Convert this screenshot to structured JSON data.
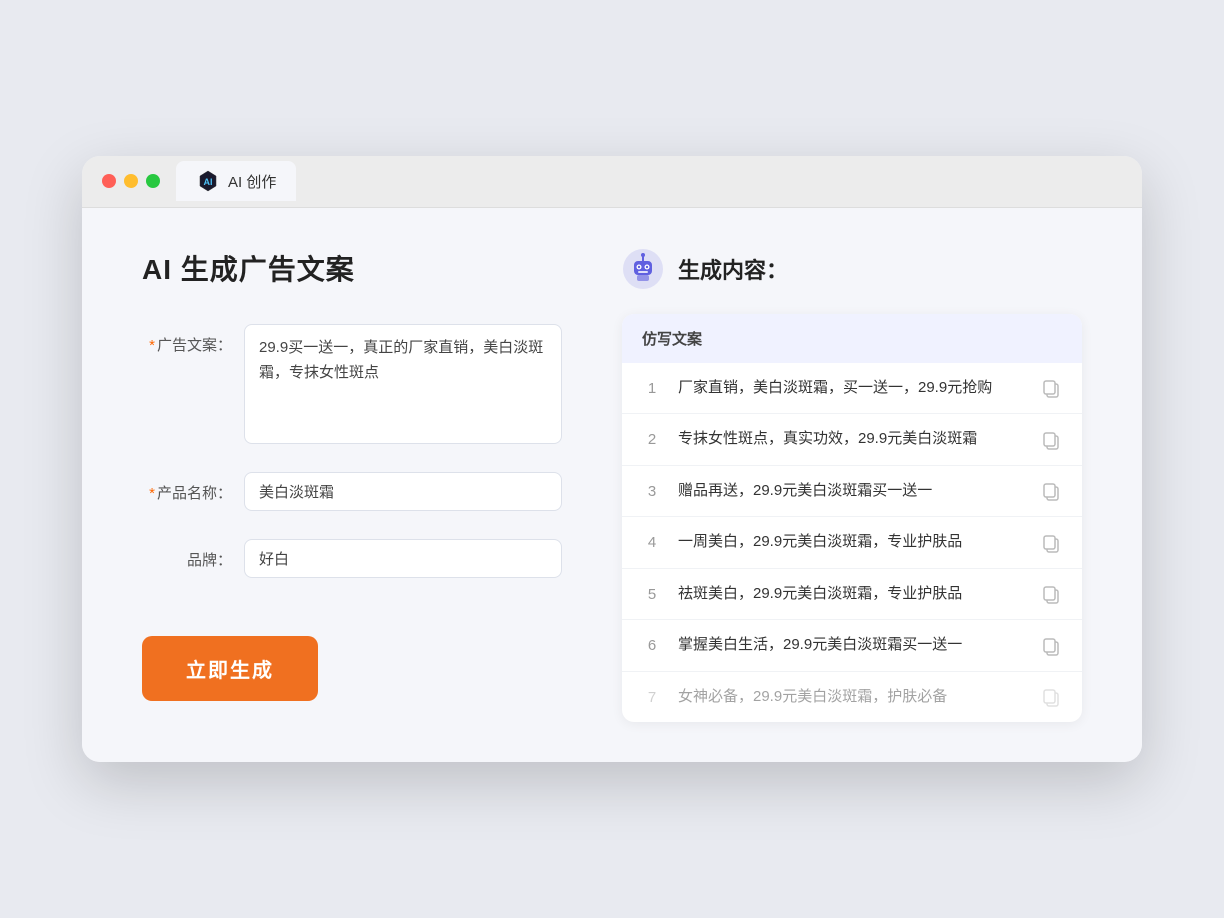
{
  "browser": {
    "tab_label": "AI 创作"
  },
  "page": {
    "title": "AI  生成广告文案"
  },
  "form": {
    "ad_copy_label": "广告文案：",
    "ad_copy_required": "*",
    "ad_copy_value": "29.9买一送一，真正的厂家直销，美白淡斑霜，专抹女性斑点",
    "product_name_label": "产品名称：",
    "product_name_required": "*",
    "product_name_value": "美白淡斑霜",
    "brand_label": "品牌：",
    "brand_value": "好白",
    "generate_btn_label": "立即生成"
  },
  "results": {
    "header_icon": "robot",
    "header_title": "生成内容：",
    "table_header": "仿写文案",
    "items": [
      {
        "num": "1",
        "text": "厂家直销，美白淡斑霜，买一送一，29.9元抢购",
        "dimmed": false
      },
      {
        "num": "2",
        "text": "专抹女性斑点，真实功效，29.9元美白淡斑霜",
        "dimmed": false
      },
      {
        "num": "3",
        "text": "赠品再送，29.9元美白淡斑霜买一送一",
        "dimmed": false
      },
      {
        "num": "4",
        "text": "一周美白，29.9元美白淡斑霜，专业护肤品",
        "dimmed": false
      },
      {
        "num": "5",
        "text": "祛斑美白，29.9元美白淡斑霜，专业护肤品",
        "dimmed": false
      },
      {
        "num": "6",
        "text": "掌握美白生活，29.9元美白淡斑霜买一送一",
        "dimmed": false
      },
      {
        "num": "7",
        "text": "女神必备，29.9元美白淡斑霜，护肤必备",
        "dimmed": true
      }
    ]
  }
}
